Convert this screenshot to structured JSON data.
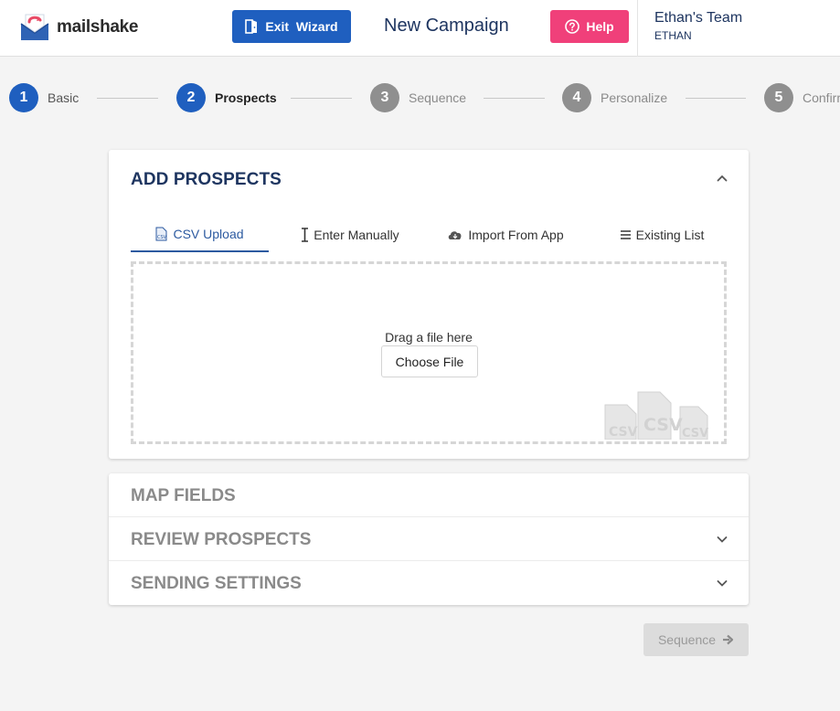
{
  "header": {
    "logo_text": "mailshake",
    "exit_label": "Exit  Wizard",
    "campaign_title": "New Campaign",
    "help_label": "Help",
    "team_name": "Ethan's Team",
    "team_user": "ETHAN"
  },
  "colors": {
    "primary": "#1f5fbf",
    "help": "#f0407a",
    "active_step": "#1f5fbf",
    "inactive_step": "#8f8f8f",
    "navy": "#1e3560"
  },
  "steps": [
    {
      "number": "1",
      "label": "Basic",
      "state": "complete"
    },
    {
      "number": "2",
      "label": "Prospects",
      "state": "active"
    },
    {
      "number": "3",
      "label": "Sequence",
      "state": "inactive"
    },
    {
      "number": "4",
      "label": "Personalize",
      "state": "inactive"
    },
    {
      "number": "5",
      "label": "Confirm",
      "state": "inactive"
    }
  ],
  "add_prospects": {
    "title": "ADD PROSPECTS",
    "tabs": [
      {
        "label": "CSV Upload",
        "icon": "csv-file-icon",
        "active": true
      },
      {
        "label": "Enter Manually",
        "icon": "text-cursor-icon",
        "active": false
      },
      {
        "label": "Import From App",
        "icon": "cloud-download-icon",
        "active": false
      },
      {
        "label": "Existing List",
        "icon": "list-icon",
        "active": false
      }
    ],
    "drop_text": "Drag a file here",
    "choose_file": "Choose File",
    "csv_art_label": "CSV"
  },
  "sections": [
    {
      "title": "MAP FIELDS",
      "has_chevron": false
    },
    {
      "title": "REVIEW PROSPECTS",
      "has_chevron": true
    },
    {
      "title": "SENDING SETTINGS",
      "has_chevron": true
    }
  ],
  "footer": {
    "next_label": "Sequence"
  }
}
